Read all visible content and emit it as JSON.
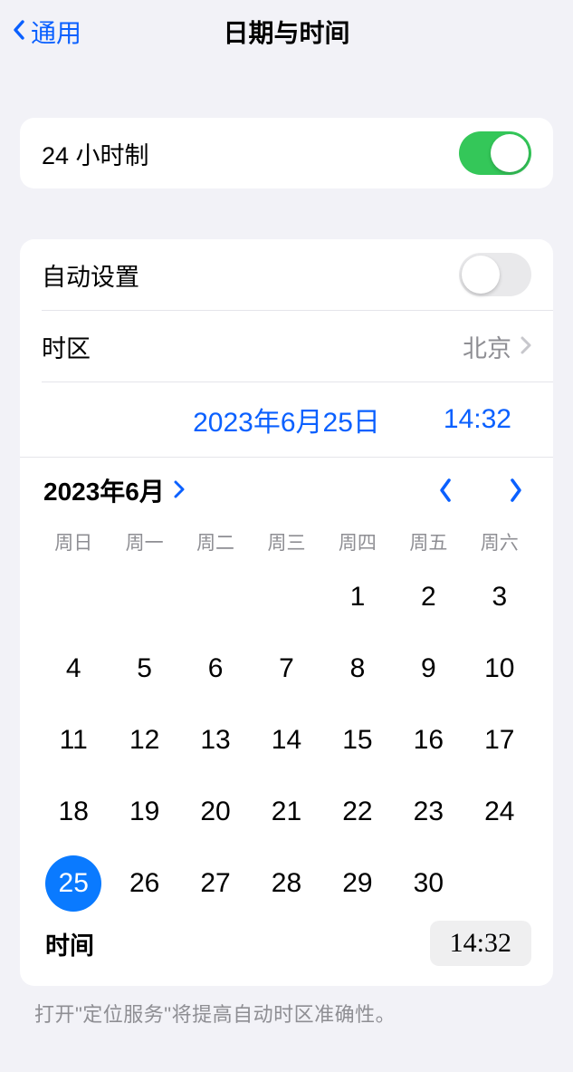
{
  "nav": {
    "back": "通用",
    "title": "日期与时间"
  },
  "s1": {
    "hour24": "24 小时制"
  },
  "s2": {
    "auto": "自动设置",
    "tz_label": "时区",
    "tz_value": "北京",
    "date": "2023年6月25日",
    "time": "14:32"
  },
  "cal": {
    "month": "2023年6月",
    "wd": [
      "周日",
      "周一",
      "周二",
      "周三",
      "周四",
      "周五",
      "周六"
    ],
    "leading_blanks": 4,
    "days_in_month": 30,
    "selected": 25
  },
  "trow": {
    "label": "时间",
    "value": "14:32"
  },
  "footer": "打开\"定位服务\"将提高自动时区准确性。"
}
